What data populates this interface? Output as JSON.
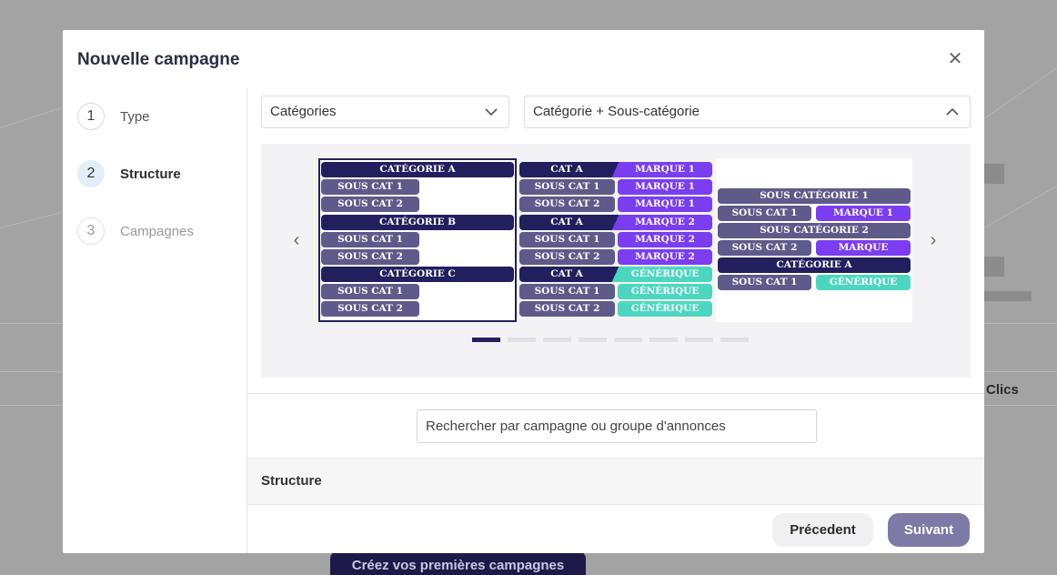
{
  "background": {
    "column_header": "Clics",
    "cta_label": "Créez vos premières campagnes"
  },
  "modal": {
    "title": "Nouvelle campagne",
    "close_icon": "close-icon",
    "steps": [
      {
        "number": "1",
        "label": "Type",
        "state": "done"
      },
      {
        "number": "2",
        "label": "Structure",
        "state": "active"
      },
      {
        "number": "3",
        "label": "Campagnes",
        "state": "pending"
      }
    ],
    "selects": {
      "left_value": "Catégories",
      "right_value": "Catégorie + Sous-catégorie"
    },
    "carousel": {
      "card1": {
        "cat_a": "CATÉGORIE A",
        "sub1": "SOUS CAT 1",
        "sub2": "SOUS CAT 2",
        "cat_b": "CATÉGORIE B",
        "sub3": "SOUS CAT 1",
        "sub4": "SOUS CAT 2",
        "cat_c": "CATÉGORIE C",
        "sub5": "SOUS CAT 1",
        "sub6": "SOUS CAT 2"
      },
      "card2": {
        "r1a": "CAT A",
        "r1b": "MARQUE 1",
        "r2a": "SOUS CAT 1",
        "r2b": "MARQUE 1",
        "r3a": "SOUS CAT 2",
        "r3b": "MARQUE 1",
        "r4a": "CAT A",
        "r4b": "MARQUE 2",
        "r5a": "SOUS CAT 1",
        "r5b": "MARQUE 2",
        "r6a": "SOUS CAT 2",
        "r6b": "MARQUE 2",
        "r7a": "CAT A",
        "r7b": "GÉNÉRIQUE",
        "r8a": "SOUS CAT 1",
        "r8b": "GÉNÉRIQUE",
        "r9a": "SOUS CAT 2",
        "r9b": "GÉNÉRIQUE"
      },
      "card3": {
        "s1": "SOUS CATÉGORIE 1",
        "r1a": "SOUS CAT 1",
        "r1b": "MARQUE 1",
        "s2": "SOUS CATÉGORIE 2",
        "r2a": "SOUS CAT 2",
        "r2b": "MARQUE",
        "cat": "CATÉGORIE A",
        "r3a": "SOUS CAT 1",
        "r3b": "GÉNÉRIQUE"
      },
      "dots_total": 8,
      "dots_active_index": 0
    },
    "search_placeholder": "Rechercher par campagne ou groupe d'annonces",
    "structure_label": "Structure",
    "buttons": {
      "previous": "Précedent",
      "next": "Suivant"
    }
  }
}
